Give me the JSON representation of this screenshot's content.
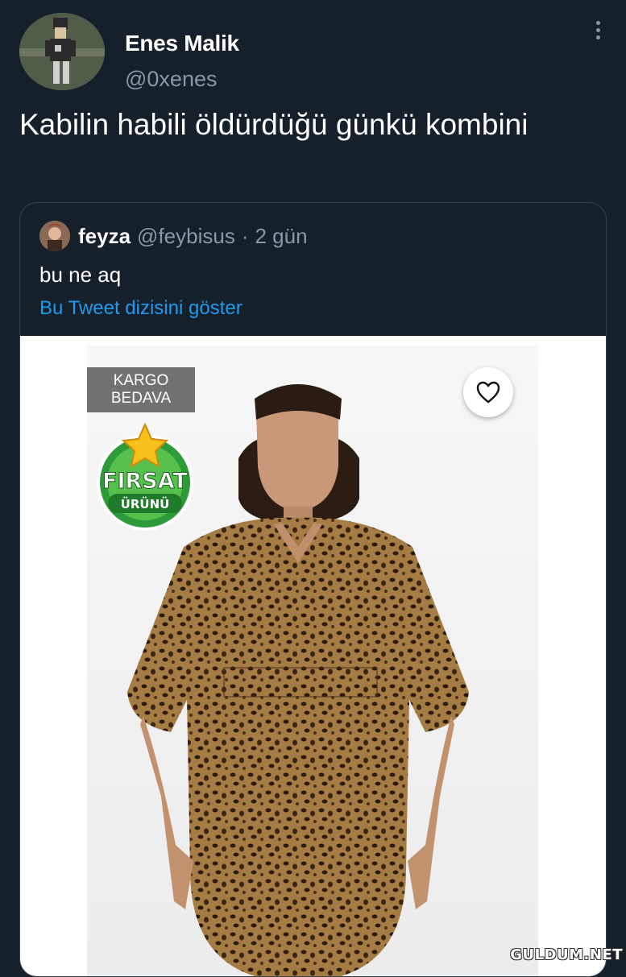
{
  "tweet": {
    "author_name": "Enes Malik",
    "author_handle": "@0xenes",
    "text": "Kabilin habili öldürdüğü günkü kombini"
  },
  "quoted_tweet": {
    "author_name": "feyza",
    "author_handle": "@feybisus",
    "separator": "·",
    "time": "2 gün",
    "text": "bu ne aq",
    "thread_link": "Bu Tweet dizisini göster"
  },
  "product_image": {
    "badge_line1": "KARGO",
    "badge_line2": "BEDAVA",
    "seal_top": "FIRSAT",
    "seal_bottom": "ÜRÜNÜ",
    "favorite_icon": "heart-icon"
  },
  "watermark": "GULDUM.NET",
  "icons": {
    "more": "more-vertical-icon"
  },
  "colors": {
    "background": "#15202b",
    "link": "#1d9bf0",
    "secondary_text": "#8899a6",
    "border": "#38444d",
    "badge_gray": "#727272",
    "seal_green": "#2e9b3a"
  }
}
